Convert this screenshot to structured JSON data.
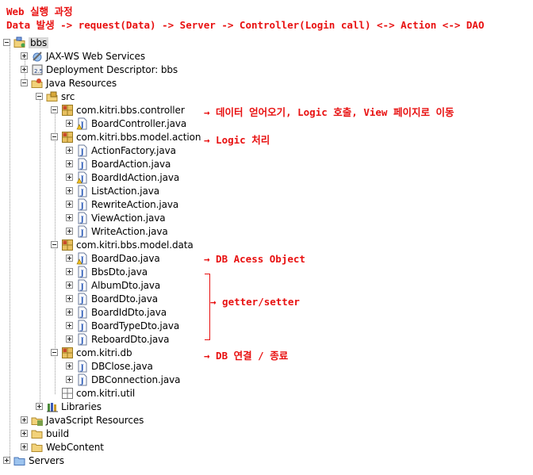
{
  "header": {
    "line1": "Web 실행 과정",
    "line2": "Data 발생 -> request(Data) -> Server -> Controller(Login call) <-> Action <-> DAO"
  },
  "tree": {
    "bbs": "bbs",
    "jaxws": "JAX-WS Web Services",
    "deployment": "Deployment Descriptor: bbs",
    "java_resources": "Java Resources",
    "src": "src",
    "pkg_controller": "com.kitri.bbs.controller",
    "board_controller": "BoardController.java",
    "pkg_action": "com.kitri.bbs.model.action",
    "action_files": [
      "ActionFactory.java",
      "BoardAction.java",
      "BoardIdAction.java",
      "ListAction.java",
      "RewriteAction.java",
      "ViewAction.java",
      "WriteAction.java"
    ],
    "pkg_data": "com.kitri.bbs.model.data",
    "data_files": [
      "BoardDao.java",
      "BbsDto.java",
      "AlbumDto.java",
      "BoardDto.java",
      "BoardIdDto.java",
      "BoardTypeDto.java",
      "ReboardDto.java"
    ],
    "pkg_db": "com.kitri.db",
    "db_files": [
      "DBClose.java",
      "DBConnection.java"
    ],
    "pkg_util": "com.kitri.util",
    "libraries": "Libraries",
    "javascript_resources": "JavaScript Resources",
    "build": "build",
    "webcontent": "WebContent",
    "servers": "Servers"
  },
  "annotations": {
    "controller": "→ 데이터 얻어오기, Logic 호출, View 페이지로 이동",
    "action": "→ Logic 처리",
    "dao": "→ DB Acess Object",
    "dto": "→ getter/setter",
    "db": "→ DB 연결 / 종료"
  },
  "colors": {
    "annotation": "#e81010",
    "package_icon": "#c8a030",
    "java_icon": "#3a6ed8"
  }
}
